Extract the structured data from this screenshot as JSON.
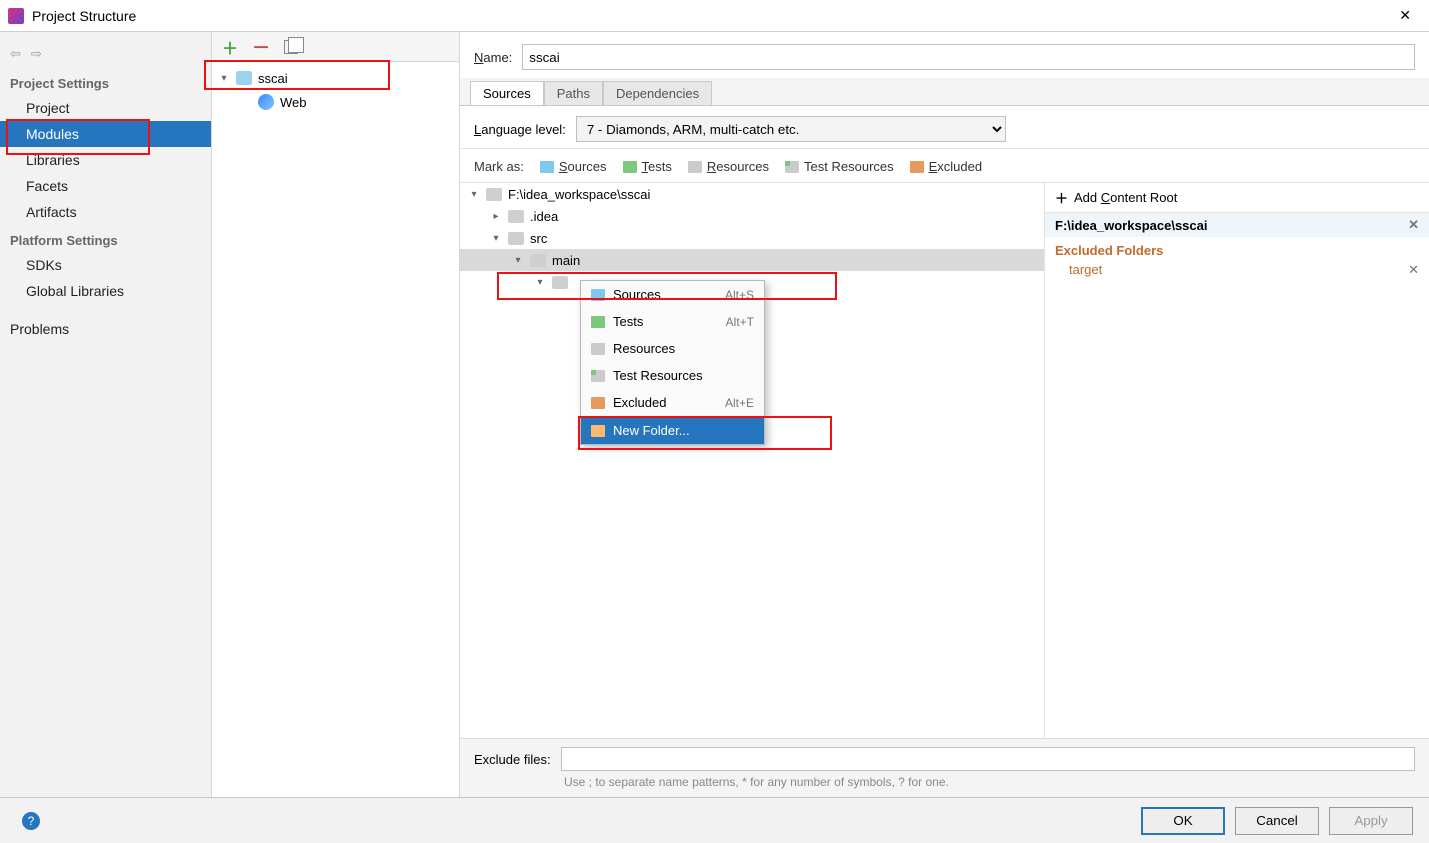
{
  "window": {
    "title": "Project Structure"
  },
  "leftnav": {
    "group1_title": "Project Settings",
    "group1": [
      "Project",
      "Modules",
      "Libraries",
      "Facets",
      "Artifacts"
    ],
    "group2_title": "Platform Settings",
    "group2": [
      "SDKs",
      "Global Libraries"
    ],
    "problems": "Problems"
  },
  "moduleTree": {
    "root": "sscai",
    "child": "Web"
  },
  "detail": {
    "name_label": "Name:",
    "name_value": "sscai",
    "tabs": [
      "Sources",
      "Paths",
      "Dependencies"
    ],
    "lang_label": "Language level:",
    "lang_value": "7 - Diamonds, ARM, multi-catch etc.",
    "mark_label": "Mark as:",
    "marks": {
      "sources": "Sources",
      "tests": "Tests",
      "resources": "Resources",
      "test_resources": "Test Resources",
      "excluded": "Excluded"
    },
    "tree": {
      "root": "F:\\idea_workspace\\sscai",
      "idea": ".idea",
      "src": "src",
      "main": "main"
    },
    "ctx": {
      "sources": "Sources",
      "sources_sc": "Alt+S",
      "tests": "Tests",
      "tests_sc": "Alt+T",
      "resources": "Resources",
      "test_resources": "Test Resources",
      "excluded": "Excluded",
      "excluded_sc": "Alt+E",
      "new_folder": "New Folder..."
    },
    "excl_label": "Exclude files:",
    "excl_hint": "Use ; to separate name patterns, * for any number of symbols, ? for one."
  },
  "roots": {
    "add_label": "Add Content Root",
    "root_path": "F:\\idea_workspace\\sscai",
    "excluded_title": "Excluded Folders",
    "excluded_item": "target"
  },
  "footer": {
    "ok": "OK",
    "cancel": "Cancel",
    "apply": "Apply"
  }
}
